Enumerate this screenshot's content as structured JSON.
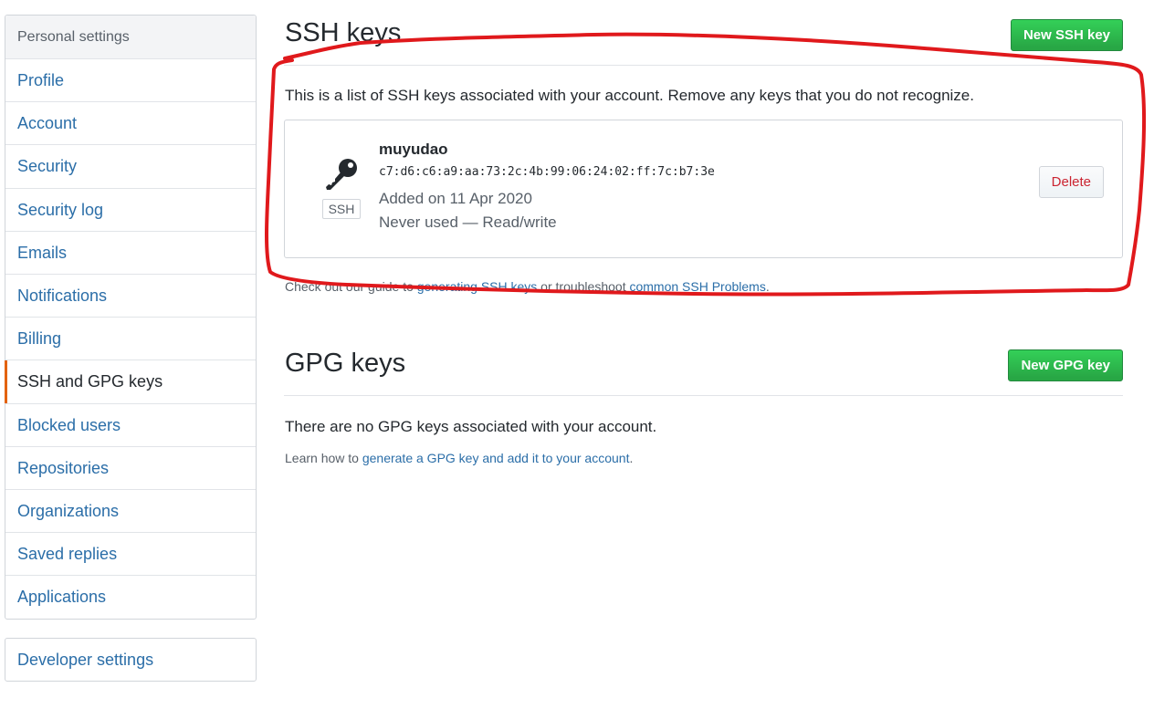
{
  "sidebar": {
    "heading": "Personal settings",
    "items": [
      {
        "label": "Profile"
      },
      {
        "label": "Account"
      },
      {
        "label": "Security"
      },
      {
        "label": "Security log"
      },
      {
        "label": "Emails"
      },
      {
        "label": "Notifications"
      },
      {
        "label": "Billing"
      },
      {
        "label": "SSH and GPG keys",
        "selected": true
      },
      {
        "label": "Blocked users"
      },
      {
        "label": "Repositories"
      },
      {
        "label": "Organizations"
      },
      {
        "label": "Saved replies"
      },
      {
        "label": "Applications"
      }
    ],
    "developer_settings": "Developer settings",
    "selected_accent": "#e36209"
  },
  "ssh": {
    "title": "SSH keys",
    "new_button": "New SSH key",
    "intro": "This is a list of SSH keys associated with your account. Remove any keys that you do not recognize.",
    "key": {
      "icon": "key-icon",
      "type_label": "SSH",
      "name": "muyudao",
      "fingerprint": "c7:d6:c6:a9:aa:73:2c:4b:99:06:24:02:ff:7c:b7:3e",
      "added": "Added on 11 Apr 2020",
      "usage": "Never used — Read/write",
      "delete_button": "Delete"
    },
    "note_prefix": "Check out our guide to ",
    "note_link1": "generating SSH keys",
    "note_middle": " or troubleshoot ",
    "note_link2": "common SSH Problems",
    "note_suffix": "."
  },
  "gpg": {
    "title": "GPG keys",
    "new_button": "New GPG key",
    "empty": "There are no GPG keys associated with your account.",
    "note_prefix": "Learn how to ",
    "note_link": "generate a GPG key and add it to your account",
    "note_suffix": "."
  },
  "colors": {
    "link": "#2b6ea8",
    "primary_button": "#28a745",
    "danger_text": "#cb2431",
    "annotation": "#e0191c"
  }
}
